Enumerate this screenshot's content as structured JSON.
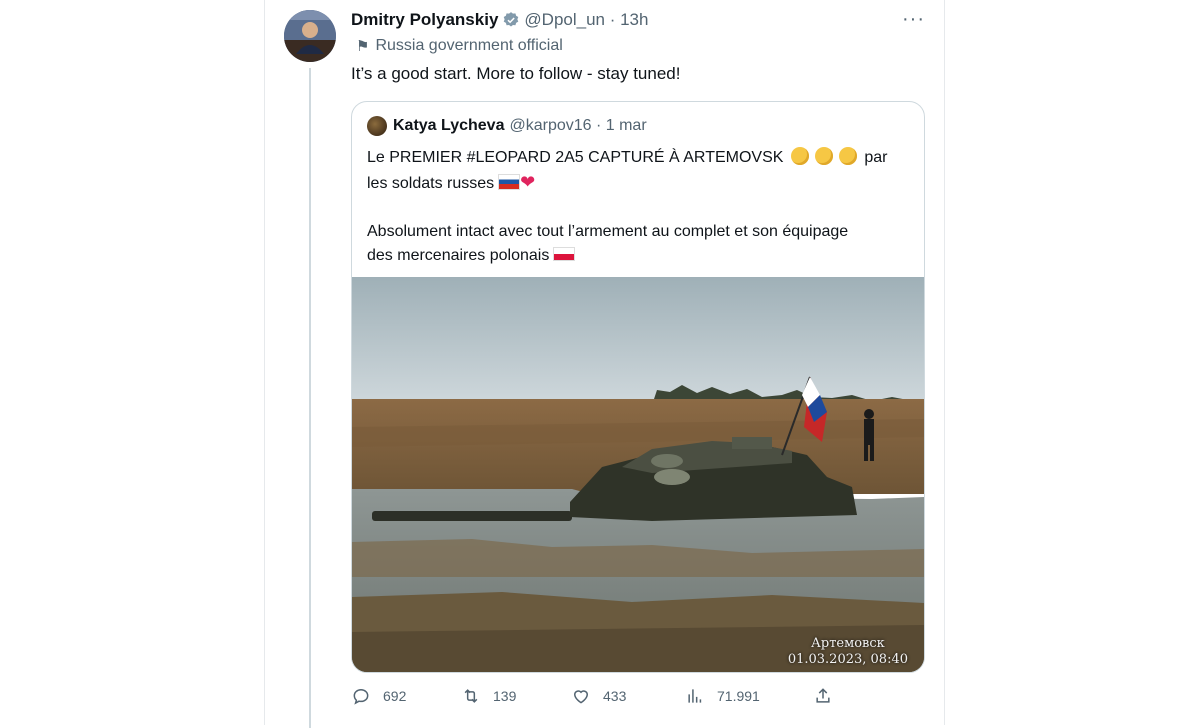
{
  "tweet": {
    "author_name": "Dmitry Polyanskiy",
    "author_handle": "@Dpol_un · 13h",
    "label": "Russia government official",
    "text": "It’s a good start. More to follow - stay tuned!",
    "more_icon": "more-horizontal-icon"
  },
  "quote": {
    "author_name": "Katya Lycheva",
    "author_handle": "@karpov16 · 1 mar",
    "line1_a": "Le PREMIER #LEOPARD 2A5 CAPTURÉ À ARTEMOVSK",
    "line1_b": "par",
    "line2": "les soldats russes",
    "line3": "Absolument intact avec tout l’armement au complet et son équipage",
    "line4": "des mercenaires polonais",
    "image_caption_place": "Артемовск",
    "image_caption_date": "01.03.2023, 08:40"
  },
  "actions": {
    "replies": "692",
    "retweets": "139",
    "likes": "433",
    "views": "71.991"
  },
  "colors": {
    "text": "#0f1419",
    "secondary": "#536471",
    "border": "#cfd9de",
    "verified_badge": "#829aab"
  }
}
